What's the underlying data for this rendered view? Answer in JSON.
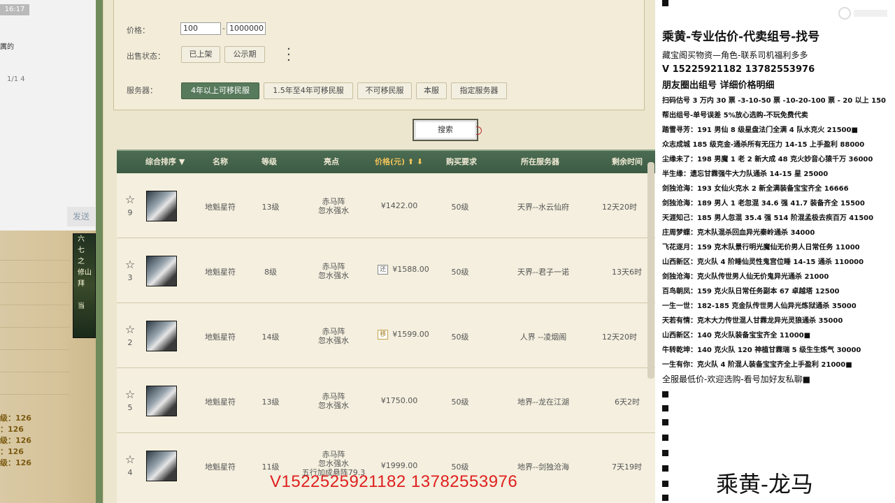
{
  "left": {
    "time": "16:17",
    "text1": "厲的",
    "text2": "1/1 4",
    "send": "发送",
    "game_lines": [
      "六",
      "七",
      "之",
      "修山",
      "拜",
      "",
      "当"
    ],
    "levels": [
      "级：126",
      "：126",
      "级：126",
      "：126",
      "级：126"
    ]
  },
  "filter": {
    "price_label": "价格：",
    "price_min": "100",
    "price_max": "1000000",
    "dash": "-",
    "status_label": "出售状态：",
    "status_options": [
      "已上架",
      "公示期"
    ],
    "server_label": "服务器：",
    "server_options": [
      "4年以上可移民服",
      "1.5年至4年可移民服",
      "不可移民服",
      "本服",
      "指定服务器"
    ],
    "search_label": "搜索"
  },
  "table": {
    "headers": {
      "sort": "综合排序 ▼",
      "name": "名称",
      "level": "等级",
      "highlight": "亮点",
      "price": "价格(元) ⬆ ⬇",
      "req": "购买要求",
      "server": "所在服务器",
      "time": "剩余时间"
    },
    "rows": [
      {
        "rank": "9",
        "name": "地魁星符",
        "level": "13级",
        "hl1": "赤马阵",
        "hl2": "忽水强水",
        "hl3": "",
        "tag": "",
        "price": "¥1422.00",
        "req": "50级",
        "server": "天界--水云仙府",
        "time": "12天20时"
      },
      {
        "rank": "3",
        "name": "地魁星符",
        "level": "8级",
        "hl1": "赤马阵",
        "hl2": "忽水强水",
        "hl3": "",
        "tag": "还",
        "price": "¥1588.00",
        "req": "50级",
        "server": "天界--君子一诺",
        "time": "13天6时"
      },
      {
        "rank": "2",
        "name": "地魁星符",
        "level": "14级",
        "hl1": "赤马阵",
        "hl2": "忽水强水",
        "hl3": "",
        "tag": "移",
        "price": "¥1599.00",
        "req": "50级",
        "server": "人界 --凌烟阁",
        "time": "12天20时"
      },
      {
        "rank": "5",
        "name": "地魁星符",
        "level": "13级",
        "hl1": "赤马阵",
        "hl2": "忽水强水",
        "hl3": "",
        "tag": "",
        "price": "¥1750.00",
        "req": "50级",
        "server": "地界--龙在江湖",
        "time": "6天2时"
      },
      {
        "rank": "4",
        "name": "地魁星符",
        "level": "11级",
        "hl1": "赤马阵",
        "hl2": "忽水强水",
        "hl3": "五行加成悬阵79.3",
        "tag": "",
        "price": "¥1999.00",
        "req": "50级",
        "server": "地界--剑独沧海",
        "time": "7天19时"
      }
    ]
  },
  "watermark": "V1522525921182  13782553976",
  "right": {
    "title": "乘黄-专业估价-代卖组号-找号",
    "lines": [
      "藏宝阁买物资—角色-联系司机福利多多",
      "V 15225921182    13782553976",
      "朋友圈出组号    详细价格明细",
      "扫码估号 3 万内 30 票 -3-10-50 票   -10-20-100 票 - 20 以上 150",
      "帮出组号-单号误差 5%放心选购-不玩免费代卖",
      "踏雪寻芳：191 男仙 8 级星盘法门全满 4 队水克火 21500■",
      "众志成城  185 级克金-通杀所有无压力 14-15 上手盈利 88000",
      "尘缘未了：198 男魔 1 老 2 新大成 48 克火妙音心猿千万 36000",
      "半生缘：遗忘甘霖强牛大力队通杀 14-15 星 25000",
      "剑独沧海：193 女仙火克水 2 新全满装备宝宝齐全 16666",
      "剑独沧海：189 男人 1 老忽混 34.6 强 41.7 装备齐全 15500",
      "天涯知己：185 男人忽混 35.4 强 514 阶混孟极去疾百万 41500",
      "庄周梦蝶：克木队混杀回血异光秦岭通杀 34000",
      "飞花逐月：159 克木队景行明光魔仙无价男人日常任务 11000",
      "山西新区：克火队 4 阶睡仙灵性鬼宫位睡 14-15 通杀 110000",
      "剑独沧海：克火队传世男人仙无价鬼异光通杀 21000",
      "百鸟朝凤：159 克火队日常任务副本 67 卓越塔 12500",
      "一生一世：182-185 克金队传世男人仙异光炼狱通杀 35000",
      "天若有情：克木大力传世混人甘霖龙异光灵狼通杀 35000",
      "山西新区：140 克火队装备宝宝齐全  11000■",
      "牛转乾坤：140 克火队 120 神植甘霖瑞 5 级生生炼气 30000",
      "一生有你：克火队 4 阶混人装备宝宝齐全上手盈利 21000■",
      "全服最低价-欢迎选购-看号加好友私聊■"
    ],
    "name": "乘黄-龙马"
  }
}
